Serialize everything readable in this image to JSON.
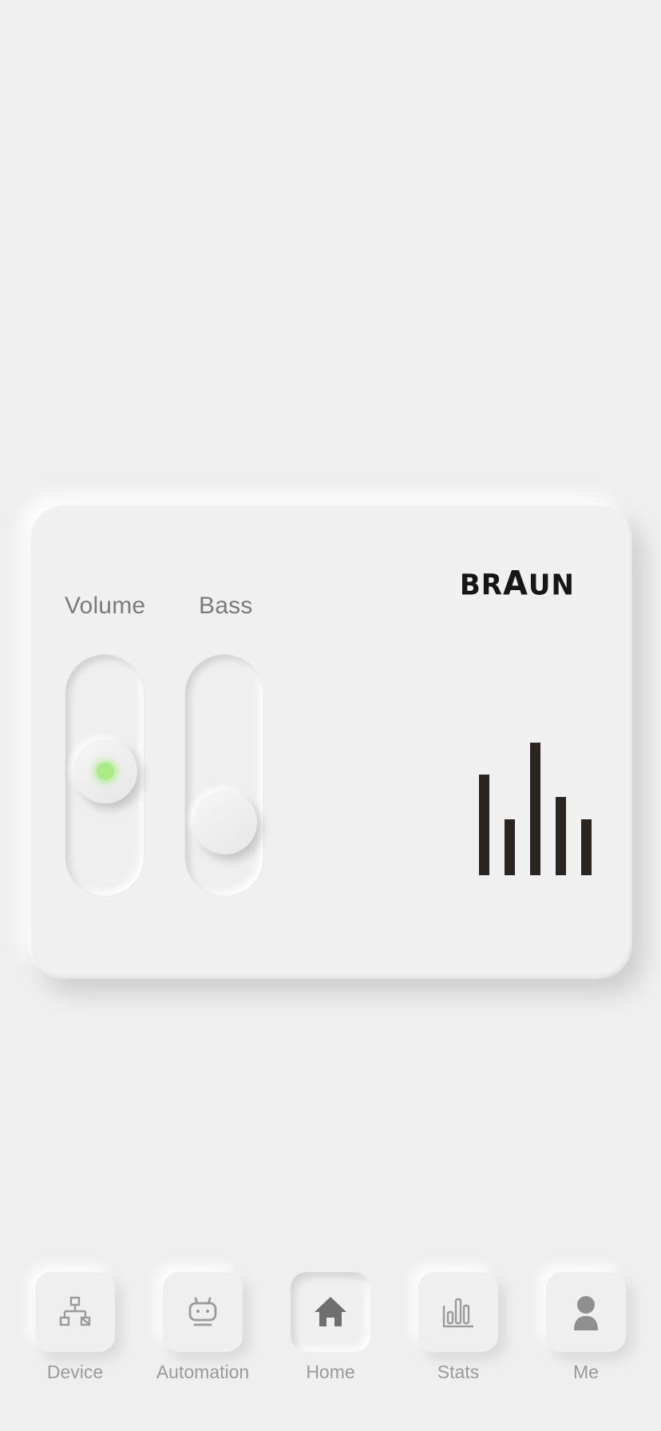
{
  "card": {
    "brand": {
      "left": "BR",
      "mid": "A",
      "right": "UN"
    },
    "sliders": {
      "volume": {
        "label": "Volume",
        "value": 0.6,
        "indicator_color": "#a9ec86"
      },
      "bass": {
        "label": "Bass",
        "value": 0.3
      }
    },
    "equalizer": {
      "color": "#2b2521",
      "levels": [
        0.76,
        0.42,
        1.0,
        0.59,
        0.42
      ]
    }
  },
  "nav": {
    "items": [
      {
        "label": "Device",
        "icon": "network-icon",
        "active": false
      },
      {
        "label": "Automation",
        "icon": "robot-icon",
        "active": false
      },
      {
        "label": "Home",
        "icon": "home-icon",
        "active": true
      },
      {
        "label": "Stats",
        "icon": "bar-chart-icon",
        "active": false
      },
      {
        "label": "Me",
        "icon": "user-icon",
        "active": false
      }
    ]
  }
}
